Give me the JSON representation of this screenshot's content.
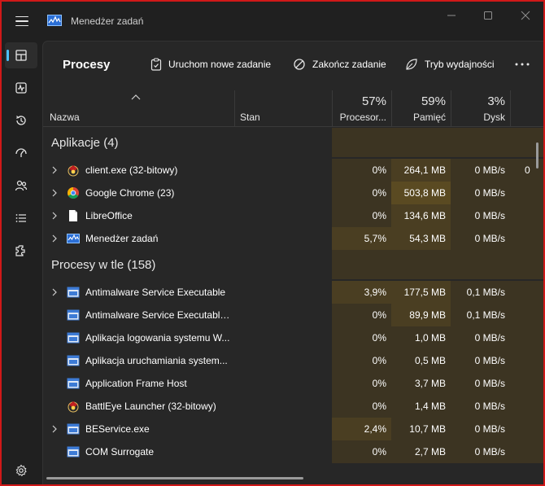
{
  "window": {
    "title": "Menedżer zadań",
    "accent": "#4cc2ff",
    "frame_color": "#d01818"
  },
  "nav": {
    "items": [
      {
        "icon": "processes-icon",
        "active": true
      },
      {
        "icon": "performance-icon",
        "active": false
      },
      {
        "icon": "app-history-icon",
        "active": false
      },
      {
        "icon": "startup-apps-icon",
        "active": false
      },
      {
        "icon": "users-icon",
        "active": false
      },
      {
        "icon": "details-icon",
        "active": false
      },
      {
        "icon": "services-icon",
        "active": false
      }
    ],
    "settings_icon": "settings-icon"
  },
  "toolbar": {
    "title": "Procesy",
    "run_new_task": "Uruchom nowe zadanie",
    "end_task": "Zakończ zadanie",
    "efficiency_mode": "Tryb wydajności",
    "more": "more-icon"
  },
  "columns": {
    "name": "Nazwa",
    "status": "Stan",
    "cpu": {
      "pct": "57%",
      "label": "Procesor..."
    },
    "memory": {
      "pct": "59%",
      "label": "Pamięć"
    },
    "disk": {
      "pct": "3%",
      "label": "Dysk"
    }
  },
  "groups": {
    "apps": "Aplikacje (4)",
    "background": "Procesy w tle (158)"
  },
  "apps": [
    {
      "name": "client.exe (32-bitowy)",
      "cpu": "0%",
      "mem": "264,1 MB",
      "disk": "0 MB/s",
      "net": "0",
      "icon": "client-exe-icon",
      "expandable": true
    },
    {
      "name": "Google Chrome (23)",
      "cpu": "0%",
      "mem": "503,8 MB",
      "disk": "0 MB/s",
      "net": "",
      "icon": "chrome-icon",
      "expandable": true
    },
    {
      "name": "LibreOffice",
      "cpu": "0%",
      "mem": "134,6 MB",
      "disk": "0 MB/s",
      "net": "",
      "icon": "document-icon",
      "expandable": true
    },
    {
      "name": "Menedżer zadań",
      "cpu": "5,7%",
      "mem": "54,3 MB",
      "disk": "0 MB/s",
      "net": "",
      "icon": "task-manager-icon",
      "expandable": true
    }
  ],
  "background": [
    {
      "name": "Antimalware Service Executable",
      "cpu": "3,9%",
      "mem": "177,5 MB",
      "disk": "0,1 MB/s",
      "icon": "service-window-icon",
      "expandable": true
    },
    {
      "name": "Antimalware Service Executable...",
      "cpu": "0%",
      "mem": "89,9 MB",
      "disk": "0,1 MB/s",
      "icon": "service-window-icon",
      "expandable": false
    },
    {
      "name": "Aplikacja logowania systemu W...",
      "cpu": "0%",
      "mem": "1,0 MB",
      "disk": "0 MB/s",
      "icon": "service-window-icon",
      "expandable": false
    },
    {
      "name": "Aplikacja uruchamiania system...",
      "cpu": "0%",
      "mem": "0,5 MB",
      "disk": "0 MB/s",
      "icon": "service-window-icon",
      "expandable": false
    },
    {
      "name": "Application Frame Host",
      "cpu": "0%",
      "mem": "3,7 MB",
      "disk": "0 MB/s",
      "icon": "service-window-icon",
      "expandable": false
    },
    {
      "name": "BattlEye Launcher (32-bitowy)",
      "cpu": "0%",
      "mem": "1,4 MB",
      "disk": "0 MB/s",
      "icon": "battleye-icon",
      "expandable": false
    },
    {
      "name": "BEService.exe",
      "cpu": "2,4%",
      "mem": "10,7 MB",
      "disk": "0 MB/s",
      "icon": "service-window-icon",
      "expandable": true
    },
    {
      "name": "COM Surrogate",
      "cpu": "0%",
      "mem": "2,7 MB",
      "disk": "0 MB/s",
      "icon": "service-window-icon",
      "expandable": false
    }
  ]
}
